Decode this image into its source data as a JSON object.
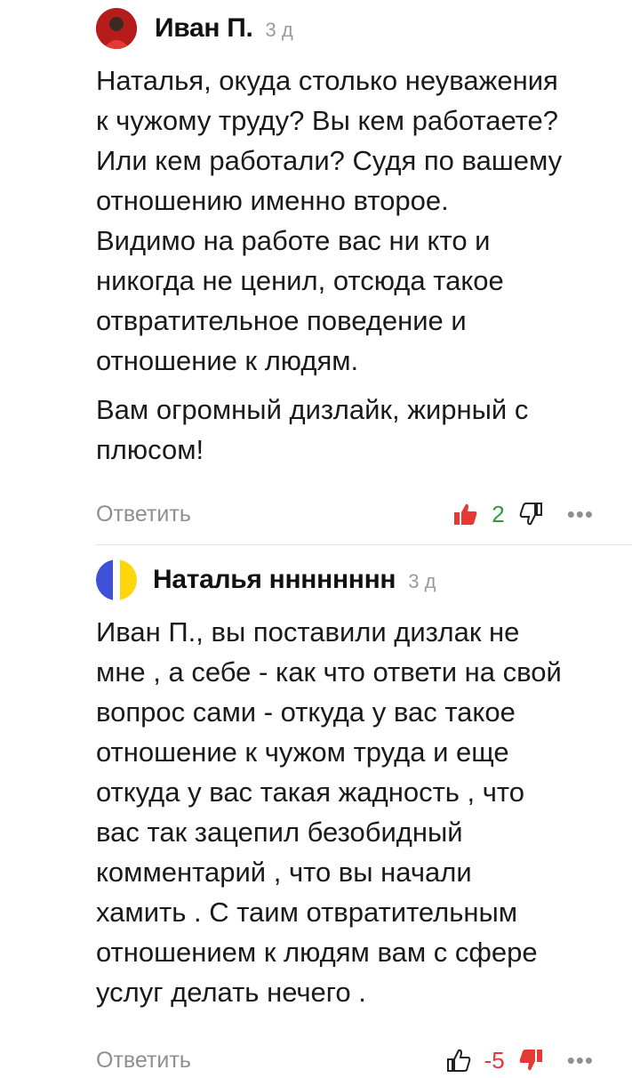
{
  "comments": [
    {
      "author": "Иван П.",
      "time": "3 д",
      "paragraphs": [
        "Наталья, окуда столько неуважения\nк чужому труду? Вы кем работаете?\nИли кем работали? Судя по вашему\nотношению именно второе.\nВидимо на работе вас ни кто и\nникогда не ценил, отсюда такое\nотвратительное поведение и\nотношение к людям.",
        "Вам огромный дизлайк, жирный с\nплюсом!"
      ],
      "reply_label": "Ответить",
      "likes": "2",
      "like_color": "#e53935",
      "more": "•••"
    },
    {
      "author": "Наталья нннннннн",
      "time": "3 д",
      "paragraphs": [
        "Иван П., вы поставили дизлак не\nмне , а себе - как что ответи на свой\nвопрос сами - откуда у вас такое\nотношение к чужом труда и еще\nоткуда у вас такая жадность , что\nвас так зацепил безобидный\nкомментарий , что вы начали\nхамить . С таим отвратительным\nотношением к людям вам с сфере\nуслуг делать нечего ."
      ],
      "reply_label": "Ответить",
      "likes": "-5",
      "dislike_color": "#e53935",
      "more": "•••"
    }
  ]
}
